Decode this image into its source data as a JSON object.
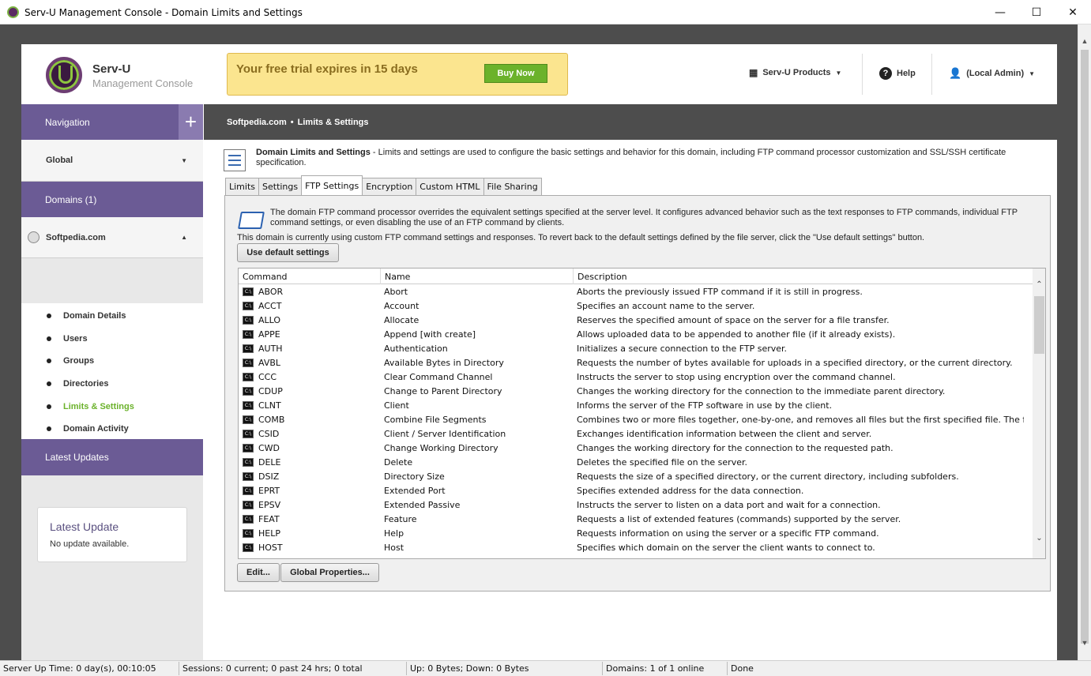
{
  "window": {
    "title": "Serv-U Management Console - Domain Limits and Settings",
    "minimize": "—",
    "maximize": "☐",
    "close": "✕"
  },
  "header": {
    "brand_name": "Serv-U",
    "brand_sub": "Management Console",
    "trial_message": "Your free trial expires in 15 days",
    "buy_now": "Buy Now",
    "products": "Serv-U Products",
    "help": "Help",
    "user": "(Local Admin)"
  },
  "sidebar": {
    "navigation": "Navigation",
    "global": "Global",
    "domains": "Domains (1)",
    "domain_name": "Softpedia.com",
    "items": [
      {
        "label": "Domain Details",
        "active": false
      },
      {
        "label": "Users",
        "active": false
      },
      {
        "label": "Groups",
        "active": false
      },
      {
        "label": "Directories",
        "active": false
      },
      {
        "label": "Limits & Settings",
        "active": true
      },
      {
        "label": "Domain Activity",
        "active": false
      }
    ],
    "latest_updates": "Latest Updates",
    "latest_update_title": "Latest Update",
    "latest_update_text": "No update available."
  },
  "breadcrumb": {
    "domain": "Softpedia.com",
    "separator": "•",
    "page": "Limits & Settings"
  },
  "intro": {
    "title": "Domain Limits and Settings",
    "text": " - Limits and settings are used to configure the basic settings and behavior for this domain, including FTP command processor customization and SSL/SSH certificate specification."
  },
  "tabs": [
    "Limits",
    "Settings",
    "FTP Settings",
    "Encryption",
    "Custom HTML",
    "File Sharing"
  ],
  "ftp": {
    "description": "The domain FTP command processor overrides the equivalent settings specified at the server level. It configures advanced behavior such as the text responses to FTP commands, individual FTP command settings, or even disabling the use of an FTP command by clients.",
    "custom_note": "This domain is currently using custom FTP command settings and responses. To revert back to the default settings defined by the file server, click the \"Use default settings\" button.",
    "use_default": "Use default settings",
    "edit": "Edit...",
    "global_properties": "Global Properties..."
  },
  "grid": {
    "columns": [
      "Command",
      "Name",
      "Description"
    ],
    "rows": [
      {
        "cmd": "ABOR",
        "name": "Abort",
        "desc": "Aborts the previously issued FTP command if it is still in progress."
      },
      {
        "cmd": "ACCT",
        "name": "Account",
        "desc": "Specifies an account name to the server."
      },
      {
        "cmd": "ALLO",
        "name": "Allocate",
        "desc": "Reserves the specified amount of space on the server for a file transfer."
      },
      {
        "cmd": "APPE",
        "name": "Append [with create]",
        "desc": "Allows uploaded data to be appended to another file (if it already exists)."
      },
      {
        "cmd": "AUTH",
        "name": "Authentication",
        "desc": "Initializes a secure connection to the FTP server."
      },
      {
        "cmd": "AVBL",
        "name": "Available Bytes in Directory",
        "desc": "Requests the number of bytes available for uploads in a specified directory, or the current directory."
      },
      {
        "cmd": "CCC",
        "name": "Clear Command Channel",
        "desc": "Instructs the server to stop using encryption over the command channel."
      },
      {
        "cmd": "CDUP",
        "name": "Change to Parent Directory",
        "desc": "Changes the working directory for the connection to the immediate parent directory."
      },
      {
        "cmd": "CLNT",
        "name": "Client",
        "desc": "Informs the server of the FTP software in use by the client."
      },
      {
        "cmd": "COMB",
        "name": "Combine File Segments",
        "desc": "Combines two or more files together, one-by-one, and removes all files but the first specified file. The first file will..."
      },
      {
        "cmd": "CSID",
        "name": "Client / Server Identification",
        "desc": "Exchanges identification information between the client and server."
      },
      {
        "cmd": "CWD",
        "name": "Change Working Directory",
        "desc": "Changes the working directory for the connection to the requested path."
      },
      {
        "cmd": "DELE",
        "name": "Delete",
        "desc": "Deletes the specified file on the server."
      },
      {
        "cmd": "DSIZ",
        "name": "Directory Size",
        "desc": "Requests the size of a specified directory, or the current directory, including subfolders."
      },
      {
        "cmd": "EPRT",
        "name": "Extended Port",
        "desc": "Specifies extended address for the data connection."
      },
      {
        "cmd": "EPSV",
        "name": "Extended Passive",
        "desc": "Instructs the server to listen on a data port and wait for a connection."
      },
      {
        "cmd": "FEAT",
        "name": "Feature",
        "desc": "Requests a list of extended features (commands) supported by the server."
      },
      {
        "cmd": "HELP",
        "name": "Help",
        "desc": "Requests information on using the server or a specific FTP command."
      },
      {
        "cmd": "HOST",
        "name": "Host",
        "desc": "Specifies which domain on the server the client wants to connect to."
      }
    ]
  },
  "status": {
    "uptime": "Server Up Time: 0 day(s), 00:10:05",
    "sessions": "Sessions: 0 current; 0 past 24 hrs; 0 total",
    "traffic": "Up: 0 Bytes; Down: 0 Bytes",
    "domains": "Domains: 1 of 1 online",
    "state": "Done"
  },
  "colors": {
    "accent_purple": "#6b5b95",
    "active_green": "#6bb22b",
    "trial_yellow": "#fbe58f"
  }
}
